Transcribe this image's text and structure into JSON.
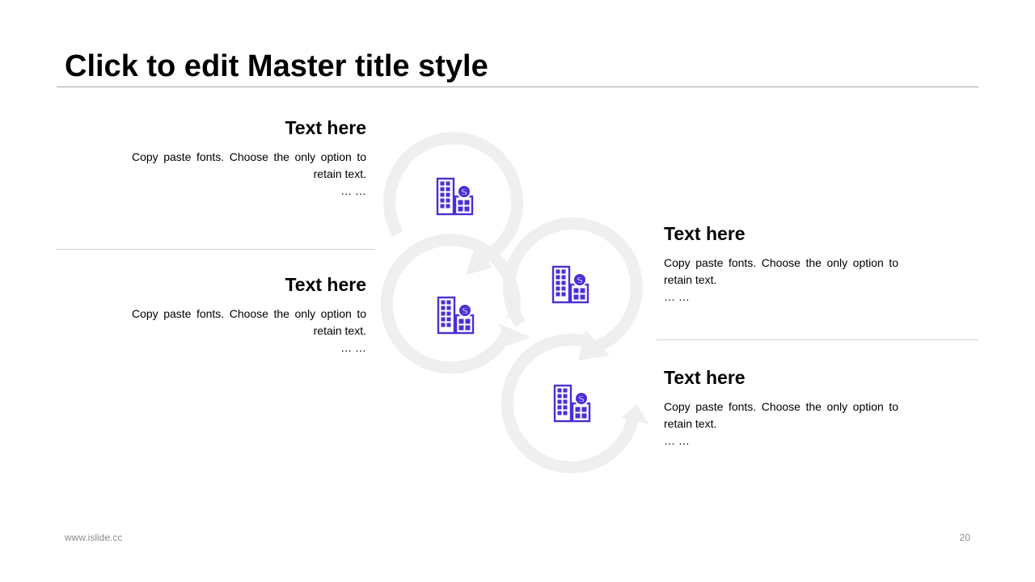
{
  "title": "Click to edit Master title style",
  "items": [
    {
      "heading": "Text here",
      "body": "Copy paste fonts. Choose the only option to retain text.",
      "ellipsis": "… …"
    },
    {
      "heading": "Text here",
      "body": "Copy paste fonts. Choose the only option to retain text.",
      "ellipsis": "… …"
    },
    {
      "heading": "Text here",
      "body": "Copy paste fonts. Choose the only option to retain text.",
      "ellipsis": "… …"
    },
    {
      "heading": "Text here",
      "body": "Copy paste fonts. Choose the only option to retain text.",
      "ellipsis": "… …"
    }
  ],
  "diagram": {
    "ring_color": "#efefef",
    "icon_color": "#4b2fd6",
    "icon_name": "building-dollar-icon"
  },
  "footer": {
    "url": "www.islide.cc",
    "page_number": "20"
  }
}
